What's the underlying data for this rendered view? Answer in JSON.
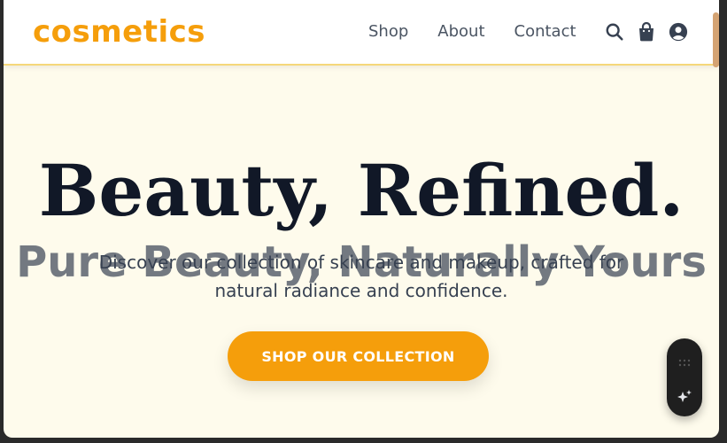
{
  "brand": {
    "name": "cosmetics"
  },
  "nav": {
    "links": [
      {
        "label": "Shop"
      },
      {
        "label": "About"
      },
      {
        "label": "Contact"
      }
    ],
    "icons": [
      "search-icon",
      "shopping-bag-icon",
      "user-account-icon"
    ]
  },
  "hero": {
    "title": "Beauty, Refined.",
    "subtitle": "Pure Beauty, Naturally Yours",
    "description": "Discover our collection of skincare and makeup, crafted for natural radiance and confidence.",
    "cta_label": "SHOP OUR COLLECTION"
  },
  "colors": {
    "accent": "#f59e0b",
    "hero_bg": "#fefbec",
    "title_text": "#111827",
    "nav_text": "#4b5563"
  }
}
